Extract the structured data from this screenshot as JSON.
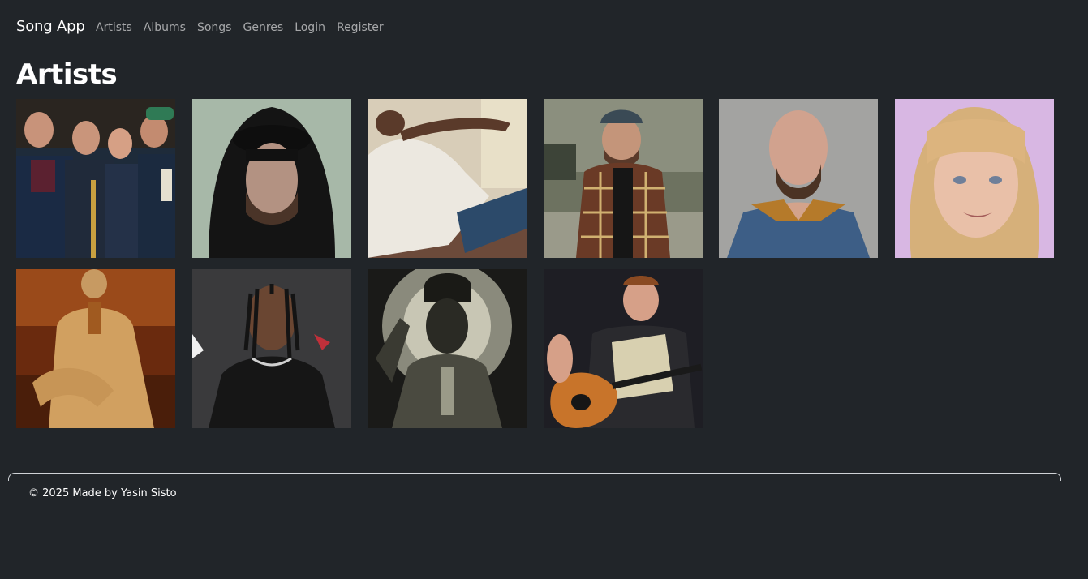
{
  "nav": {
    "brand": "Song App",
    "links": [
      "Artists",
      "Albums",
      "Songs",
      "Genres",
      "Login",
      "Register"
    ]
  },
  "page": {
    "title": "Artists"
  },
  "artists": [
    {
      "icon": "band-photo"
    },
    {
      "icon": "hooded-man-photo"
    },
    {
      "icon": "reclining-man-photo"
    },
    {
      "icon": "flannel-cap-man-photo"
    },
    {
      "icon": "tattooed-man-photo"
    },
    {
      "icon": "blonde-woman-photo"
    },
    {
      "icon": "suited-man-orange-photo"
    },
    {
      "icon": "braided-man-photo"
    },
    {
      "icon": "monochrome-portrait-photo"
    },
    {
      "icon": "guitarist-photo"
    }
  ],
  "footer": {
    "text": "© 2025 Made by Yasin Sisto"
  },
  "colors": {
    "background": "#212529",
    "nav_link": "rgba(255,255,255,0.6)",
    "text": "#ffffff"
  }
}
